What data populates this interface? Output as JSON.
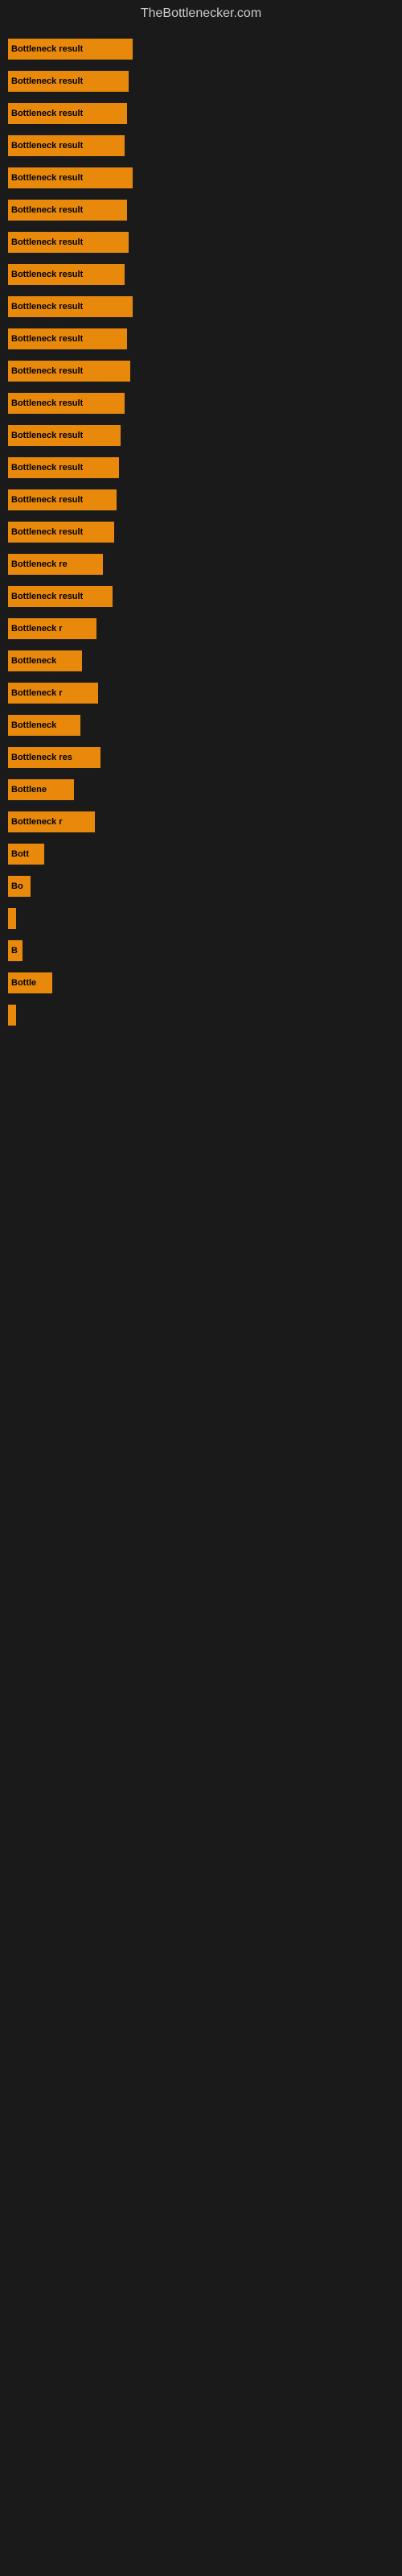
{
  "site": {
    "title": "TheBottlenecker.com"
  },
  "bars": [
    {
      "label": "Bottleneck result",
      "width": 155
    },
    {
      "label": "Bottleneck result",
      "width": 150
    },
    {
      "label": "Bottleneck result",
      "width": 148
    },
    {
      "label": "Bottleneck result",
      "width": 145
    },
    {
      "label": "Bottleneck result",
      "width": 155
    },
    {
      "label": "Bottleneck result",
      "width": 148
    },
    {
      "label": "Bottleneck result",
      "width": 150
    },
    {
      "label": "Bottleneck result",
      "width": 145
    },
    {
      "label": "Bottleneck result",
      "width": 155
    },
    {
      "label": "Bottleneck result",
      "width": 148
    },
    {
      "label": "Bottleneck result",
      "width": 152
    },
    {
      "label": "Bottleneck result",
      "width": 145
    },
    {
      "label": "Bottleneck result",
      "width": 140
    },
    {
      "label": "Bottleneck result",
      "width": 138
    },
    {
      "label": "Bottleneck result",
      "width": 135
    },
    {
      "label": "Bottleneck result",
      "width": 132
    },
    {
      "label": "Bottleneck re",
      "width": 118
    },
    {
      "label": "Bottleneck result",
      "width": 130
    },
    {
      "label": "Bottleneck r",
      "width": 110
    },
    {
      "label": "Bottleneck",
      "width": 92
    },
    {
      "label": "Bottleneck r",
      "width": 112
    },
    {
      "label": "Bottleneck",
      "width": 90
    },
    {
      "label": "Bottleneck res",
      "width": 115
    },
    {
      "label": "Bottlene",
      "width": 82
    },
    {
      "label": "Bottleneck r",
      "width": 108
    },
    {
      "label": "Bott",
      "width": 45
    },
    {
      "label": "Bo",
      "width": 28
    },
    {
      "label": "",
      "width": 8
    },
    {
      "label": "B",
      "width": 18
    },
    {
      "label": "Bottle",
      "width": 55
    },
    {
      "label": "",
      "width": 5
    }
  ]
}
